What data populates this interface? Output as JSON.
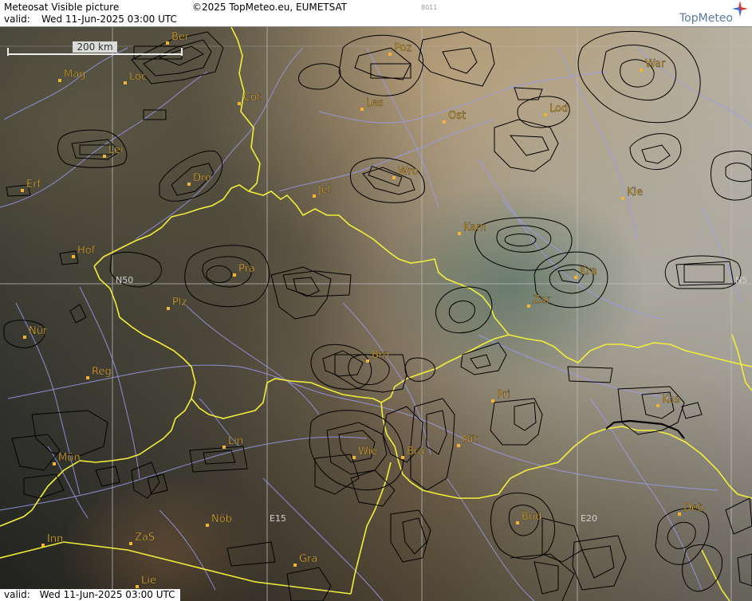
{
  "header": {
    "title": "Meteosat Visible picture",
    "copyright": "©2025 TopMeteo.eu, EUMETSAT",
    "valid_label": "valid:",
    "valid_time": "Wed  11-Jun-2025  03:00 UTC",
    "image_id": "8011",
    "logo": "TopMeteo"
  },
  "scale": {
    "label": "200 km"
  },
  "grid_labels": {
    "n50_left": "N50",
    "n50_right": "N5",
    "e15": "E15",
    "e20": "E20"
  },
  "cities": [
    {
      "name": "Ber"
    },
    {
      "name": "Poz"
    },
    {
      "name": "War"
    },
    {
      "name": "Mag"
    },
    {
      "name": "Loc"
    },
    {
      "name": "Cot"
    },
    {
      "name": "Les"
    },
    {
      "name": "Ost"
    },
    {
      "name": "Lod"
    },
    {
      "name": "Lei"
    },
    {
      "name": "Wro"
    },
    {
      "name": "Dre"
    },
    {
      "name": "Jel"
    },
    {
      "name": "Kie"
    },
    {
      "name": "Erf"
    },
    {
      "name": "Kam"
    },
    {
      "name": "Hof"
    },
    {
      "name": "Pra"
    },
    {
      "name": "Kra"
    },
    {
      "name": "Zar"
    },
    {
      "name": "Plz"
    },
    {
      "name": "Nür"
    },
    {
      "name": "Brn"
    },
    {
      "name": "Reg"
    },
    {
      "name": "Pri"
    },
    {
      "name": "Kos"
    },
    {
      "name": "Lin"
    },
    {
      "name": "Nit"
    },
    {
      "name": "Wie"
    },
    {
      "name": "Bra"
    },
    {
      "name": "Mün"
    },
    {
      "name": "Nöb"
    },
    {
      "name": "Bud"
    },
    {
      "name": "Deb"
    },
    {
      "name": "Inn"
    },
    {
      "name": "ZaS"
    },
    {
      "name": "Gra"
    },
    {
      "name": "Lie"
    }
  ],
  "colors": {
    "border": "#f2ee3a",
    "river": "#9a9cf0",
    "city_label": "#f2b431",
    "contour": "#000000",
    "grid": "#bfbfbf"
  }
}
